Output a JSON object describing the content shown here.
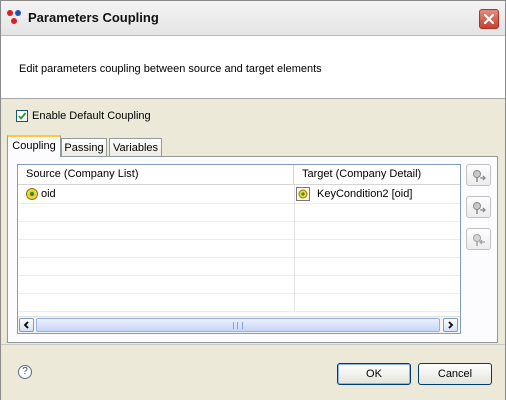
{
  "window": {
    "title": "Parameters Coupling",
    "close_icon": "close-icon"
  },
  "header": {
    "description": "Edit parameters coupling between source and target elements"
  },
  "options": {
    "enable_default_coupling_label": "Enable Default Coupling",
    "enable_default_coupling_checked": true
  },
  "tabs": [
    {
      "label": "Coupling",
      "active": true
    },
    {
      "label": "Passing",
      "active": false
    },
    {
      "label": "Variables",
      "active": false
    }
  ],
  "table": {
    "columns": [
      "Source (Company List)",
      "Target (Company Detail)"
    ],
    "rows": [
      {
        "source": "oid",
        "source_icon": "parameter-icon",
        "target": "KeyCondition2 [oid]",
        "target_icon": "key-condition-icon"
      }
    ]
  },
  "side_buttons": [
    {
      "name": "add-coupling-button",
      "icon": "add-coupling-icon",
      "enabled": true
    },
    {
      "name": "edit-coupling-button",
      "icon": "edit-coupling-icon",
      "enabled": true
    },
    {
      "name": "remove-coupling-button",
      "icon": "remove-coupling-icon",
      "enabled": false
    }
  ],
  "footer": {
    "help_icon": "help-icon",
    "help_glyph": "?",
    "ok_label": "OK",
    "cancel_label": "Cancel"
  },
  "colors": {
    "close_button": "#c4422f",
    "tab_highlight": "#ffc83c",
    "checkbox_check": "#21a121"
  }
}
